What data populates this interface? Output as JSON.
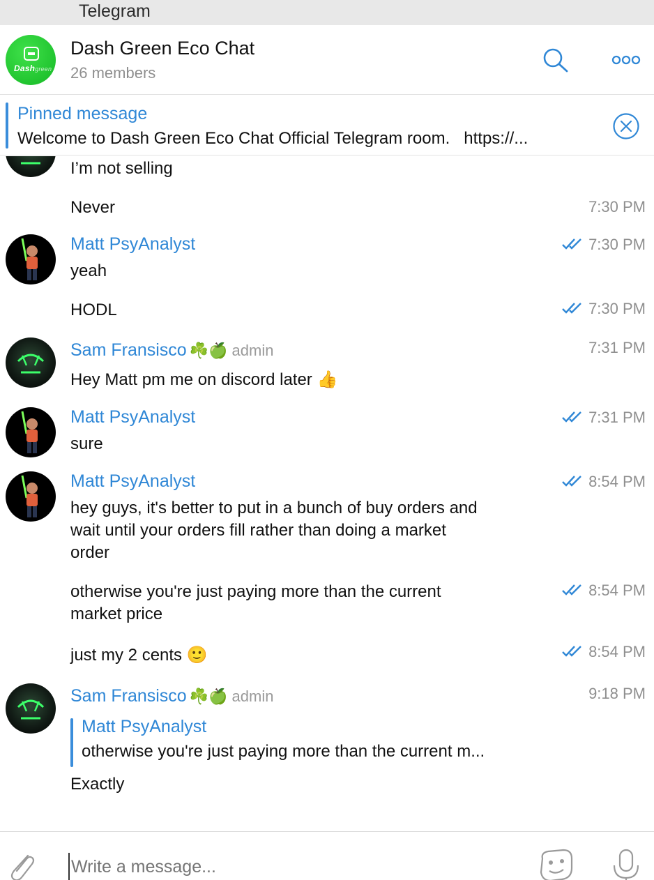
{
  "window": {
    "title": "Telegram"
  },
  "header": {
    "chat_title": "Dash Green Eco Chat",
    "members": "26 members",
    "avatar_logo": {
      "brand": "Dash",
      "sub": "green"
    },
    "icons": [
      "search-icon",
      "more-icon"
    ]
  },
  "pinned": {
    "title": "Pinned message",
    "text": "Welcome to Dash Green Eco Chat Official Telegram room.   https://...",
    "icons": [
      "close-icon"
    ]
  },
  "messages": [
    {
      "text": "I’m not selling"
    },
    {
      "text": "Never",
      "time": "7:30 PM"
    },
    {
      "sender": "Matt PsyAnalyst",
      "text": "yeah",
      "time": "7:30 PM",
      "read": true
    },
    {
      "text": "HODL",
      "time": "7:30 PM",
      "read": true
    },
    {
      "sender": "Sam Fransisco",
      "badges": "☘️🍏",
      "role": "admin",
      "text": "Hey Matt pm me on discord later 👍",
      "time": "7:31 PM"
    },
    {
      "sender": "Matt PsyAnalyst",
      "text": "sure",
      "time": "7:31 PM",
      "read": true
    },
    {
      "sender": "Matt PsyAnalyst",
      "lines": [
        "hey guys, it's better to put in a bunch of buy orders and",
        "wait until your orders fill rather than doing a market",
        "order"
      ],
      "time": "8:54 PM",
      "read": true
    },
    {
      "lines": [
        "otherwise you're just paying more than the current",
        "market price"
      ],
      "time": "8:54 PM",
      "read": true
    },
    {
      "text": "just my 2 cents 🙂",
      "time": "8:54 PM",
      "read": true
    },
    {
      "sender": "Sam Fransisco",
      "badges": "☘️🍏",
      "role": "admin",
      "time": "9:18 PM",
      "reply": {
        "name": "Matt PsyAnalyst",
        "text": "otherwise you're just paying more than the current m..."
      },
      "text": "Exactly"
    }
  ],
  "composer": {
    "placeholder": "Write a message...",
    "icons": [
      "paperclip-icon",
      "sticker-icon",
      "microphone-icon"
    ]
  },
  "colors": {
    "accent": "#2f87d6",
    "timestamp": "#8f8f8f",
    "titlebar": "#e8e8e8",
    "avatar_green": "#1fc42e"
  }
}
